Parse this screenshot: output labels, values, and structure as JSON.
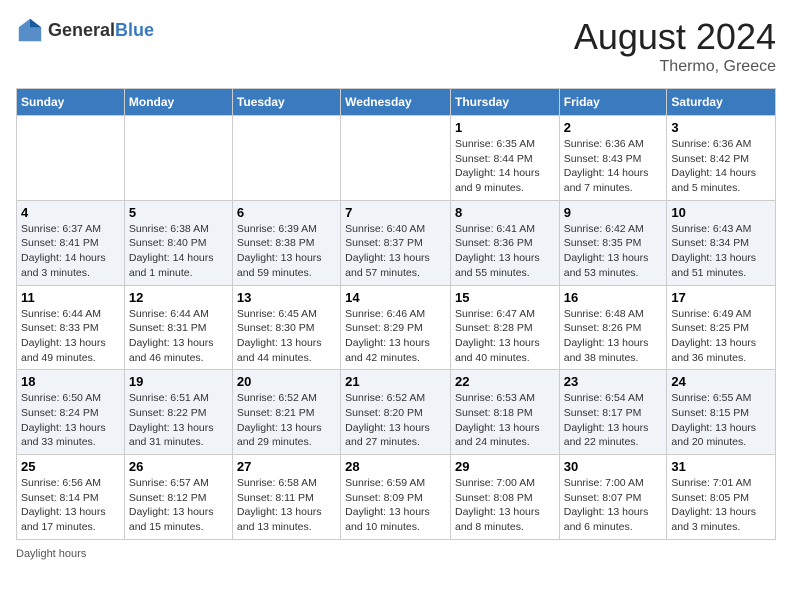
{
  "header": {
    "logo_general": "General",
    "logo_blue": "Blue",
    "month_year": "August 2024",
    "location": "Thermo, Greece"
  },
  "footer": {
    "daylight_label": "Daylight hours"
  },
  "days_of_week": [
    "Sunday",
    "Monday",
    "Tuesday",
    "Wednesday",
    "Thursday",
    "Friday",
    "Saturday"
  ],
  "weeks": [
    [
      {
        "day": "",
        "info": ""
      },
      {
        "day": "",
        "info": ""
      },
      {
        "day": "",
        "info": ""
      },
      {
        "day": "",
        "info": ""
      },
      {
        "day": "1",
        "info": "Sunrise: 6:35 AM\nSunset: 8:44 PM\nDaylight: 14 hours and 9 minutes."
      },
      {
        "day": "2",
        "info": "Sunrise: 6:36 AM\nSunset: 8:43 PM\nDaylight: 14 hours and 7 minutes."
      },
      {
        "day": "3",
        "info": "Sunrise: 6:36 AM\nSunset: 8:42 PM\nDaylight: 14 hours and 5 minutes."
      }
    ],
    [
      {
        "day": "4",
        "info": "Sunrise: 6:37 AM\nSunset: 8:41 PM\nDaylight: 14 hours and 3 minutes."
      },
      {
        "day": "5",
        "info": "Sunrise: 6:38 AM\nSunset: 8:40 PM\nDaylight: 14 hours and 1 minute."
      },
      {
        "day": "6",
        "info": "Sunrise: 6:39 AM\nSunset: 8:38 PM\nDaylight: 13 hours and 59 minutes."
      },
      {
        "day": "7",
        "info": "Sunrise: 6:40 AM\nSunset: 8:37 PM\nDaylight: 13 hours and 57 minutes."
      },
      {
        "day": "8",
        "info": "Sunrise: 6:41 AM\nSunset: 8:36 PM\nDaylight: 13 hours and 55 minutes."
      },
      {
        "day": "9",
        "info": "Sunrise: 6:42 AM\nSunset: 8:35 PM\nDaylight: 13 hours and 53 minutes."
      },
      {
        "day": "10",
        "info": "Sunrise: 6:43 AM\nSunset: 8:34 PM\nDaylight: 13 hours and 51 minutes."
      }
    ],
    [
      {
        "day": "11",
        "info": "Sunrise: 6:44 AM\nSunset: 8:33 PM\nDaylight: 13 hours and 49 minutes."
      },
      {
        "day": "12",
        "info": "Sunrise: 6:44 AM\nSunset: 8:31 PM\nDaylight: 13 hours and 46 minutes."
      },
      {
        "day": "13",
        "info": "Sunrise: 6:45 AM\nSunset: 8:30 PM\nDaylight: 13 hours and 44 minutes."
      },
      {
        "day": "14",
        "info": "Sunrise: 6:46 AM\nSunset: 8:29 PM\nDaylight: 13 hours and 42 minutes."
      },
      {
        "day": "15",
        "info": "Sunrise: 6:47 AM\nSunset: 8:28 PM\nDaylight: 13 hours and 40 minutes."
      },
      {
        "day": "16",
        "info": "Sunrise: 6:48 AM\nSunset: 8:26 PM\nDaylight: 13 hours and 38 minutes."
      },
      {
        "day": "17",
        "info": "Sunrise: 6:49 AM\nSunset: 8:25 PM\nDaylight: 13 hours and 36 minutes."
      }
    ],
    [
      {
        "day": "18",
        "info": "Sunrise: 6:50 AM\nSunset: 8:24 PM\nDaylight: 13 hours and 33 minutes."
      },
      {
        "day": "19",
        "info": "Sunrise: 6:51 AM\nSunset: 8:22 PM\nDaylight: 13 hours and 31 minutes."
      },
      {
        "day": "20",
        "info": "Sunrise: 6:52 AM\nSunset: 8:21 PM\nDaylight: 13 hours and 29 minutes."
      },
      {
        "day": "21",
        "info": "Sunrise: 6:52 AM\nSunset: 8:20 PM\nDaylight: 13 hours and 27 minutes."
      },
      {
        "day": "22",
        "info": "Sunrise: 6:53 AM\nSunset: 8:18 PM\nDaylight: 13 hours and 24 minutes."
      },
      {
        "day": "23",
        "info": "Sunrise: 6:54 AM\nSunset: 8:17 PM\nDaylight: 13 hours and 22 minutes."
      },
      {
        "day": "24",
        "info": "Sunrise: 6:55 AM\nSunset: 8:15 PM\nDaylight: 13 hours and 20 minutes."
      }
    ],
    [
      {
        "day": "25",
        "info": "Sunrise: 6:56 AM\nSunset: 8:14 PM\nDaylight: 13 hours and 17 minutes."
      },
      {
        "day": "26",
        "info": "Sunrise: 6:57 AM\nSunset: 8:12 PM\nDaylight: 13 hours and 15 minutes."
      },
      {
        "day": "27",
        "info": "Sunrise: 6:58 AM\nSunset: 8:11 PM\nDaylight: 13 hours and 13 minutes."
      },
      {
        "day": "28",
        "info": "Sunrise: 6:59 AM\nSunset: 8:09 PM\nDaylight: 13 hours and 10 minutes."
      },
      {
        "day": "29",
        "info": "Sunrise: 7:00 AM\nSunset: 8:08 PM\nDaylight: 13 hours and 8 minutes."
      },
      {
        "day": "30",
        "info": "Sunrise: 7:00 AM\nSunset: 8:07 PM\nDaylight: 13 hours and 6 minutes."
      },
      {
        "day": "31",
        "info": "Sunrise: 7:01 AM\nSunset: 8:05 PM\nDaylight: 13 hours and 3 minutes."
      }
    ]
  ]
}
